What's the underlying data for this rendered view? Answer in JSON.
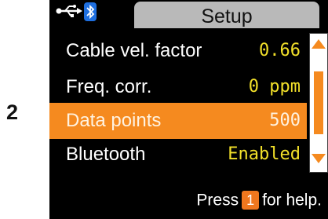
{
  "step_number": "2",
  "device": {
    "title": "Setup",
    "status_icons": [
      "usb-icon",
      "bluetooth-icon"
    ],
    "menu": [
      {
        "label": "Cable vel. factor",
        "value": "0.66",
        "selected": false
      },
      {
        "label": "Freq. corr.",
        "value": "0 ppm",
        "selected": false
      },
      {
        "label": "Data points",
        "value": "500",
        "selected": true
      },
      {
        "label": "Bluetooth",
        "value": "Enabled",
        "selected": false
      }
    ],
    "help": {
      "prefix": "Press",
      "key": "1",
      "suffix": "for help."
    }
  },
  "colors": {
    "screen_background": "#000000",
    "value_text": "#f2e02a",
    "highlight": "#f58a1f",
    "title_tab": "#b9b9b9",
    "bluetooth": "#1e6fe0"
  }
}
